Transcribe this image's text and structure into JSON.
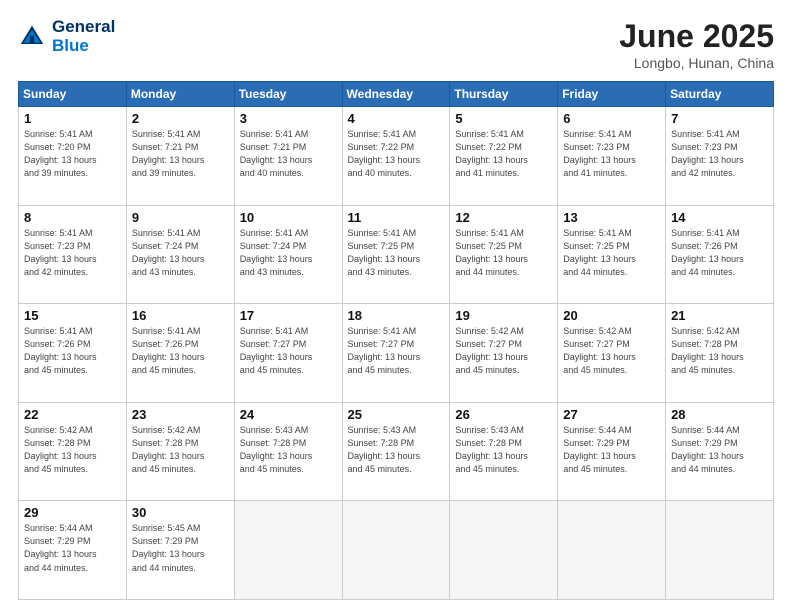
{
  "header": {
    "logo_line1": "General",
    "logo_line2": "Blue",
    "title": "June 2025",
    "subtitle": "Longbo, Hunan, China"
  },
  "weekdays": [
    "Sunday",
    "Monday",
    "Tuesday",
    "Wednesday",
    "Thursday",
    "Friday",
    "Saturday"
  ],
  "days": [
    {
      "num": "",
      "info": ""
    },
    {
      "num": "",
      "info": ""
    },
    {
      "num": "",
      "info": ""
    },
    {
      "num": "",
      "info": ""
    },
    {
      "num": "",
      "info": ""
    },
    {
      "num": "",
      "info": ""
    },
    {
      "num": "1",
      "info": "Sunrise: 5:41 AM\nSunset: 7:20 PM\nDaylight: 13 hours\nand 39 minutes."
    },
    {
      "num": "2",
      "info": "Sunrise: 5:41 AM\nSunset: 7:21 PM\nDaylight: 13 hours\nand 39 minutes."
    },
    {
      "num": "3",
      "info": "Sunrise: 5:41 AM\nSunset: 7:21 PM\nDaylight: 13 hours\nand 40 minutes."
    },
    {
      "num": "4",
      "info": "Sunrise: 5:41 AM\nSunset: 7:22 PM\nDaylight: 13 hours\nand 40 minutes."
    },
    {
      "num": "5",
      "info": "Sunrise: 5:41 AM\nSunset: 7:22 PM\nDaylight: 13 hours\nand 41 minutes."
    },
    {
      "num": "6",
      "info": "Sunrise: 5:41 AM\nSunset: 7:23 PM\nDaylight: 13 hours\nand 41 minutes."
    },
    {
      "num": "7",
      "info": "Sunrise: 5:41 AM\nSunset: 7:23 PM\nDaylight: 13 hours\nand 42 minutes."
    },
    {
      "num": "8",
      "info": "Sunrise: 5:41 AM\nSunset: 7:23 PM\nDaylight: 13 hours\nand 42 minutes."
    },
    {
      "num": "9",
      "info": "Sunrise: 5:41 AM\nSunset: 7:24 PM\nDaylight: 13 hours\nand 43 minutes."
    },
    {
      "num": "10",
      "info": "Sunrise: 5:41 AM\nSunset: 7:24 PM\nDaylight: 13 hours\nand 43 minutes."
    },
    {
      "num": "11",
      "info": "Sunrise: 5:41 AM\nSunset: 7:25 PM\nDaylight: 13 hours\nand 43 minutes."
    },
    {
      "num": "12",
      "info": "Sunrise: 5:41 AM\nSunset: 7:25 PM\nDaylight: 13 hours\nand 44 minutes."
    },
    {
      "num": "13",
      "info": "Sunrise: 5:41 AM\nSunset: 7:25 PM\nDaylight: 13 hours\nand 44 minutes."
    },
    {
      "num": "14",
      "info": "Sunrise: 5:41 AM\nSunset: 7:26 PM\nDaylight: 13 hours\nand 44 minutes."
    },
    {
      "num": "15",
      "info": "Sunrise: 5:41 AM\nSunset: 7:26 PM\nDaylight: 13 hours\nand 45 minutes."
    },
    {
      "num": "16",
      "info": "Sunrise: 5:41 AM\nSunset: 7:26 PM\nDaylight: 13 hours\nand 45 minutes."
    },
    {
      "num": "17",
      "info": "Sunrise: 5:41 AM\nSunset: 7:27 PM\nDaylight: 13 hours\nand 45 minutes."
    },
    {
      "num": "18",
      "info": "Sunrise: 5:41 AM\nSunset: 7:27 PM\nDaylight: 13 hours\nand 45 minutes."
    },
    {
      "num": "19",
      "info": "Sunrise: 5:42 AM\nSunset: 7:27 PM\nDaylight: 13 hours\nand 45 minutes."
    },
    {
      "num": "20",
      "info": "Sunrise: 5:42 AM\nSunset: 7:27 PM\nDaylight: 13 hours\nand 45 minutes."
    },
    {
      "num": "21",
      "info": "Sunrise: 5:42 AM\nSunset: 7:28 PM\nDaylight: 13 hours\nand 45 minutes."
    },
    {
      "num": "22",
      "info": "Sunrise: 5:42 AM\nSunset: 7:28 PM\nDaylight: 13 hours\nand 45 minutes."
    },
    {
      "num": "23",
      "info": "Sunrise: 5:42 AM\nSunset: 7:28 PM\nDaylight: 13 hours\nand 45 minutes."
    },
    {
      "num": "24",
      "info": "Sunrise: 5:43 AM\nSunset: 7:28 PM\nDaylight: 13 hours\nand 45 minutes."
    },
    {
      "num": "25",
      "info": "Sunrise: 5:43 AM\nSunset: 7:28 PM\nDaylight: 13 hours\nand 45 minutes."
    },
    {
      "num": "26",
      "info": "Sunrise: 5:43 AM\nSunset: 7:28 PM\nDaylight: 13 hours\nand 45 minutes."
    },
    {
      "num": "27",
      "info": "Sunrise: 5:44 AM\nSunset: 7:29 PM\nDaylight: 13 hours\nand 45 minutes."
    },
    {
      "num": "28",
      "info": "Sunrise: 5:44 AM\nSunset: 7:29 PM\nDaylight: 13 hours\nand 44 minutes."
    },
    {
      "num": "29",
      "info": "Sunrise: 5:44 AM\nSunset: 7:29 PM\nDaylight: 13 hours\nand 44 minutes."
    },
    {
      "num": "30",
      "info": "Sunrise: 5:45 AM\nSunset: 7:29 PM\nDaylight: 13 hours\nand 44 minutes."
    },
    {
      "num": "",
      "info": ""
    },
    {
      "num": "",
      "info": ""
    },
    {
      "num": "",
      "info": ""
    },
    {
      "num": "",
      "info": ""
    },
    {
      "num": "",
      "info": ""
    }
  ]
}
